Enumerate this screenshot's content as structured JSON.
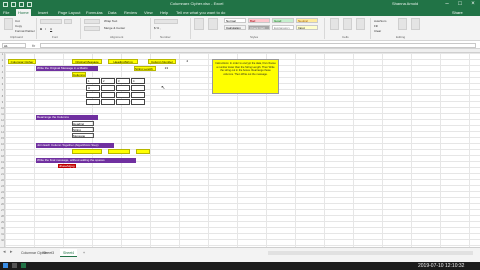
{
  "window": {
    "title": "Columnarx Cipher.xlsx - Excel",
    "user": "Shanna Arnold"
  },
  "tabs": [
    "File",
    "Home",
    "Insert",
    "Page Layout",
    "Formulas",
    "Data",
    "Review",
    "View",
    "Help",
    "Tell me what you want to do",
    "Share"
  ],
  "ribbon": {
    "groups": [
      "Clipboard",
      "Font",
      "Alignment",
      "Number",
      "Styles",
      "Cells",
      "Editing"
    ],
    "clipboard": [
      "Cut",
      "Copy",
      "Format Painter"
    ],
    "font": [
      "B",
      "I",
      "U"
    ],
    "alignment": [
      "Wrap Text",
      "Merge & Center"
    ],
    "number": [
      "$ % ,"
    ],
    "styles": [
      "Normal",
      "Bad",
      "Good",
      "Neutral",
      "Calculation",
      "Check Cell",
      "Explanatory",
      "Input"
    ],
    "editing": [
      "AutoSum",
      "Fill",
      "Clear"
    ]
  },
  "formula": {
    "cell": "A1",
    "fx": "fx"
  },
  "sheet": {
    "header": [
      "Columnar Cipher",
      "Original Message",
      "HeadingString",
      "Column Number",
      "4"
    ],
    "note": "Instructions: In order to encrypt the data, first choose a number lower than the String Length. Then Write the string out in the boxes. Rearrange these columns. Then Write out the message.",
    "steps": [
      "Write the Original Message in a Matrix",
      "Rearrange the Columns",
      "Join Each Column Together (Algorithmic Step)",
      "Write the final message, without adding the spaces"
    ],
    "string_length_label": "String Length",
    "string_length_value": "13",
    "columns_label": "Columns",
    "grid_headers": [
      "1",
      "2",
      "3",
      "4"
    ],
    "grid_rows": [
      [
        "H",
        "",
        "",
        ""
      ],
      [
        "",
        "",
        "",
        ""
      ],
      [
        "",
        "",
        "",
        ""
      ]
    ],
    "rearranged": [
      "Heading",
      "String",
      "Message"
    ],
    "encrypted": "dhaseMgsg"
  },
  "sheets": [
    "Columnar Cipher",
    "Sheet3",
    "Sheet4",
    "+"
  ],
  "taskbar": {
    "clock": "2019-07-10 12:10:32"
  }
}
